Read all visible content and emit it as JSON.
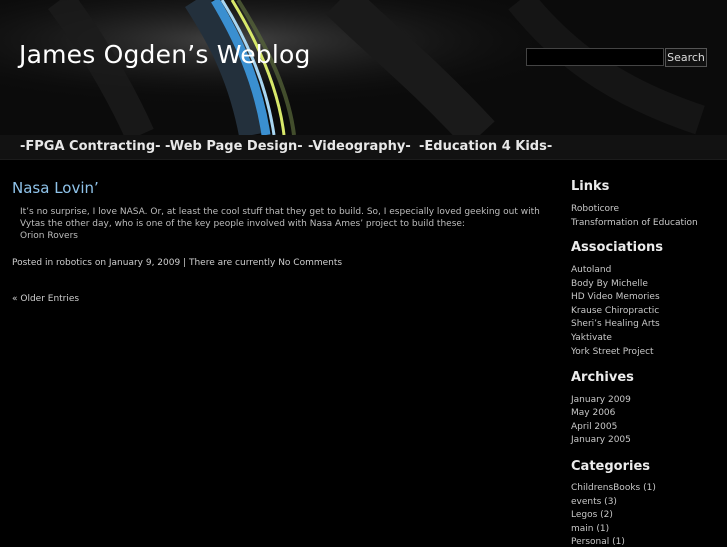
{
  "header": {
    "blog_title": "James Ogden’s Weblog",
    "search": {
      "placeholder": "",
      "value": "",
      "button_label": "Search"
    }
  },
  "nav": {
    "items": [
      {
        "label": "-FPGA Contracting-"
      },
      {
        "label": "-Web Page Design-"
      },
      {
        "label": "-Videography-"
      },
      {
        "label": "-Education 4 Kids-"
      }
    ]
  },
  "post": {
    "title": "Nasa Lovin’",
    "body_line1": "It’s no surprise, I love NASA. Or, at least the cool stuff that they get to build. So, I especially loved geeking out with",
    "body_line2": "Vytas the other day, who is one of the key people involved with Nasa Ames’ project to build these:",
    "body_link": "Orion Rovers",
    "meta_prefix": "Posted in",
    "meta_category": "robotics",
    "meta_date": "on January 9, 2009 |",
    "meta_comments": "There are currently No Comments"
  },
  "pagination": {
    "older_label": "« Older Entries"
  },
  "sidebar": {
    "links": {
      "heading": "Links",
      "items": [
        "Roboticore",
        "Transformation of Education"
      ]
    },
    "associations": {
      "heading": "Associations",
      "items": [
        "Autoland",
        "Body By Michelle",
        "HD Video Memories",
        "Krause Chiropractic",
        "Sheri’s Healing Arts",
        "Yaktivate",
        "York Street Project"
      ]
    },
    "archives": {
      "heading": "Archives",
      "items": [
        "January 2009",
        "May 2006",
        "April 2005",
        "January 2005"
      ]
    },
    "categories": {
      "heading": "Categories",
      "items": [
        "ChildrensBooks (1)",
        "events (3)",
        "Legos (2)",
        "main (1)",
        "Personal (1)"
      ]
    }
  },
  "colors": {
    "background": "#000000",
    "post_title": "#8fc3ea",
    "header_arc_blue": "#3a8fd0",
    "header_arc_yellow": "#d8e86a"
  }
}
